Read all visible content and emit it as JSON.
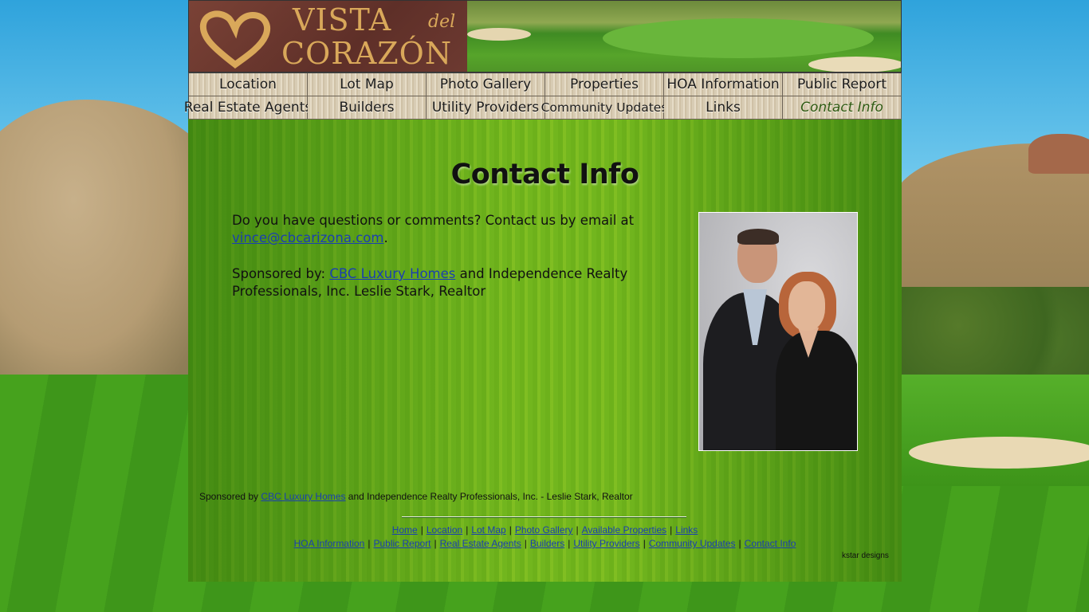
{
  "site": {
    "logo_vista": "VISTA",
    "logo_del": "del",
    "logo_corazon": "CORAZÓN"
  },
  "nav": {
    "row1": [
      "Location",
      "Lot Map",
      "Photo Gallery",
      "Properties",
      "HOA Information",
      "Public Report"
    ],
    "row2": [
      "Real Estate Agents",
      "Builders",
      "Utility Providers",
      "Community Updates",
      "Links",
      "Contact Info"
    ],
    "active": "Contact Info"
  },
  "main": {
    "title": "Contact Info",
    "question_text": "Do you have questions or comments? Contact us by email at",
    "email": "vince@cbcarizona.com",
    "email_suffix": ".",
    "sponsored_label": "Sponsored by:",
    "sponsor_link": "CBC Luxury Homes",
    "sponsored_rest": "and Independence Realty Professionals, Inc. Leslie Stark, Realtor"
  },
  "footer": {
    "sponsor_prefix": "Sponsored by",
    "sponsor_link": "CBC Luxury Homes",
    "sponsor_rest": "and Independence Realty Professionals, Inc. - Leslie Stark, Realtor",
    "links_line1": [
      "Home",
      "Location",
      "Lot Map",
      "Photo Gallery",
      "Available Properties",
      "Links"
    ],
    "links_line2": [
      "HOA Information",
      "Public Report",
      "Real Estate Agents",
      "Builders",
      "Utility Providers",
      "Community Updates",
      "Contact Info"
    ],
    "separator": "|",
    "credit": "kstar designs"
  },
  "colors": {
    "link": "#1a3fb0",
    "page_green": "#6fb31f",
    "logo_gold": "#d9a85a",
    "logo_brown": "#6d3a31"
  }
}
